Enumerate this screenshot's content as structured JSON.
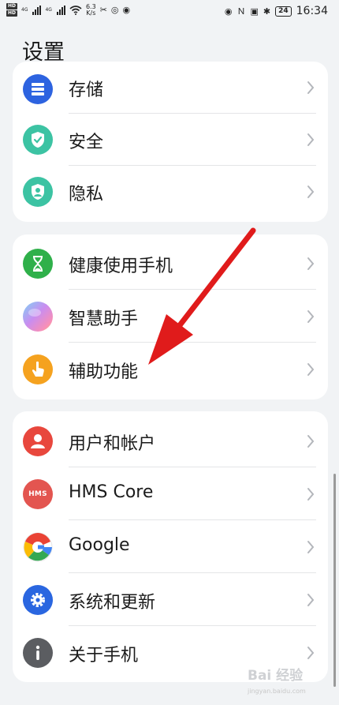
{
  "status_bar": {
    "sim1_badge": "HD",
    "sim2_badge": "HD",
    "net_type_1": "4G",
    "net_type_2": "4G",
    "net_speed_value": "6.3",
    "net_speed_unit": "K/s",
    "battery": "24",
    "time": "16:34"
  },
  "page": {
    "title": "设置"
  },
  "groups": [
    {
      "items": [
        {
          "label": "存储",
          "icon": "storage-icon",
          "color": "#2d63e0"
        },
        {
          "label": "安全",
          "icon": "shield-check-icon",
          "color": "#3cc3a3"
        },
        {
          "label": "隐私",
          "icon": "privacy-shield-icon",
          "color": "#3cc3a3"
        }
      ]
    },
    {
      "items": [
        {
          "label": "健康使用手机",
          "icon": "hourglass-icon",
          "color": "#2fb04a"
        },
        {
          "label": "智慧助手",
          "icon": "assistant-orb-icon",
          "color": "#f07fc8"
        },
        {
          "label": "辅助功能",
          "icon": "hand-pointer-icon",
          "color": "#f5a21f"
        }
      ]
    },
    {
      "items": [
        {
          "label": "用户和帐户",
          "icon": "user-icon",
          "color": "#e8473d"
        },
        {
          "label": "HMS Core",
          "icon": "hms-logo-icon",
          "color": "#e35550"
        },
        {
          "label": "Google",
          "icon": "google-logo-icon",
          "color": "#ffffff"
        },
        {
          "label": "系统和更新",
          "icon": "gear-icon",
          "color": "#2a66e0"
        },
        {
          "label": "关于手机",
          "icon": "info-icon",
          "color": "#5b5d61"
        }
      ]
    }
  ],
  "icon_text": {
    "hms": "HMS"
  },
  "annotation": {
    "arrow_color": "#e01b1b"
  },
  "watermark": {
    "main": "Bai 经验",
    "sub": "jingyan.baidu.com"
  }
}
